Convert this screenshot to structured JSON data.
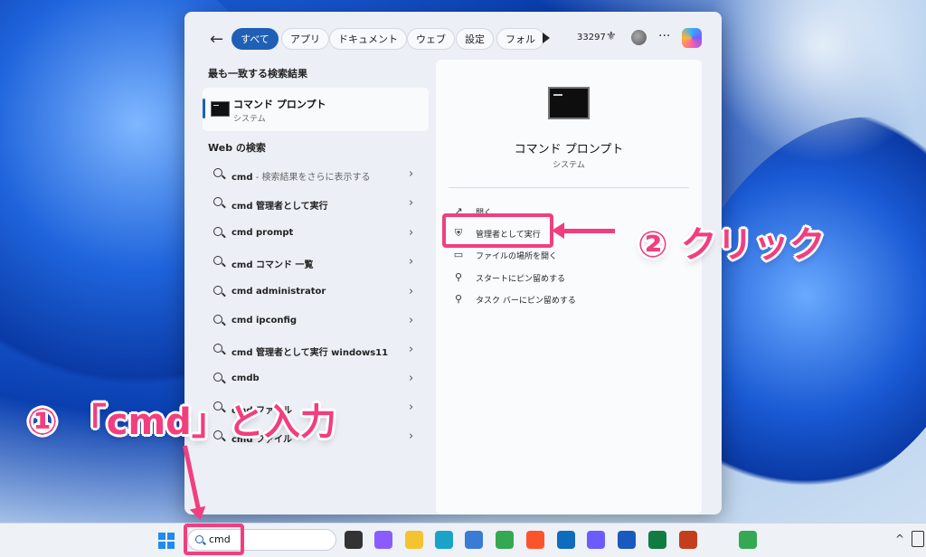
{
  "filters": {
    "chips": [
      {
        "label": "すべて",
        "active": true
      },
      {
        "label": "アプリ",
        "active": false
      },
      {
        "label": "ドキュメント",
        "active": false
      },
      {
        "label": "ウェブ",
        "active": false
      },
      {
        "label": "設定",
        "active": false
      },
      {
        "label": "フォル",
        "active": false
      }
    ],
    "points": "33297"
  },
  "best_match": {
    "heading": "最も一致する検索結果",
    "name": "コマンド プロンプト",
    "type": "システム"
  },
  "web": {
    "heading": "Web の検索",
    "items": [
      {
        "bold": "cmd",
        "rest": " - 検索結果をさらに表示する"
      },
      {
        "bold": "cmd 管理者として実行",
        "rest": ""
      },
      {
        "bold": "cmd prompt",
        "rest": ""
      },
      {
        "bold": "cmd コマンド 一覧",
        "rest": ""
      },
      {
        "bold": "cmd administrator",
        "rest": ""
      },
      {
        "bold": "cmd ipconfig",
        "rest": ""
      },
      {
        "bold": "cmd 管理者として実行 windows11",
        "rest": ""
      },
      {
        "bold": "cmdb",
        "rest": ""
      },
      {
        "bold": "cmd ファイル",
        "rest": ""
      },
      {
        "bold": "cmd ファイル",
        "rest": ""
      }
    ]
  },
  "detail": {
    "name": "コマンド プロンプト",
    "type": "システム",
    "actions": [
      {
        "icon": "open-icon",
        "glyph": "↗",
        "label": "開く"
      },
      {
        "icon": "admin-shield-icon",
        "glyph": "⛨",
        "label": "管理者として実行"
      },
      {
        "icon": "folder-icon",
        "glyph": "▭",
        "label": "ファイルの場所を開く"
      },
      {
        "icon": "pin-icon",
        "glyph": "⚲",
        "label": "スタートにピン留めする"
      },
      {
        "icon": "pin-icon",
        "glyph": "⚲",
        "label": "タスク バーにピン留めする"
      }
    ]
  },
  "annotations": {
    "step1": "① 「cmd」と入力",
    "step2": "② クリック",
    "color": "#f23e7e"
  },
  "taskbar": {
    "search_value": "cmd",
    "apps": [
      {
        "name": "task-view-icon",
        "color": "#333333"
      },
      {
        "name": "copilot-icon",
        "color": "#8a5cff"
      },
      {
        "name": "file-explorer-icon",
        "color": "#f4c430"
      },
      {
        "name": "edge-icon",
        "color": "#1aa3c9"
      },
      {
        "name": "store-icon",
        "color": "#3a7bd5"
      },
      {
        "name": "chrome-icon",
        "color": "#34a853"
      },
      {
        "name": "brave-icon",
        "color": "#fb542b"
      },
      {
        "name": "outlook-icon",
        "color": "#0f6cbd"
      },
      {
        "name": "copilot-app-icon",
        "color": "#6a5cff"
      },
      {
        "name": "word-icon",
        "color": "#185abd"
      },
      {
        "name": "excel-icon",
        "color": "#107c41"
      },
      {
        "name": "powerpoint-icon",
        "color": "#c43e1c"
      },
      {
        "name": "chrome-profile-icon",
        "color": "#34a853"
      }
    ]
  }
}
